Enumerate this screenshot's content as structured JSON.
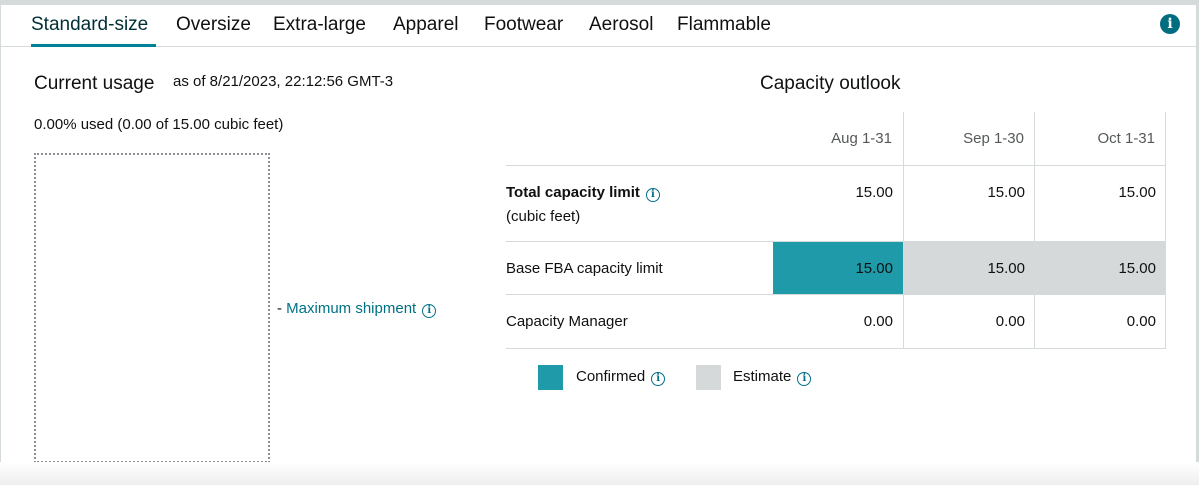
{
  "tabs": [
    {
      "label": "Standard-size",
      "active": true
    },
    {
      "label": "Oversize",
      "active": false
    },
    {
      "label": "Extra-large",
      "active": false
    },
    {
      "label": "Apparel",
      "active": false
    },
    {
      "label": "Footwear",
      "active": false
    },
    {
      "label": "Aerosol",
      "active": false
    },
    {
      "label": "Flammable",
      "active": false
    }
  ],
  "info_icon": "info-icon",
  "current_usage": {
    "title": "Current usage",
    "as_of": "as of 8/21/2023, 22:12:56 GMT-3",
    "used_text": "0.00% used (0.00 of 15.00 cubic feet)",
    "used_percent": 0,
    "max_shipment_dash": "-",
    "max_shipment_label": "Maximum shipment"
  },
  "capacity_outlook": {
    "title": "Capacity outlook",
    "columns": [
      "Aug 1-31",
      "Sep 1-30",
      "Oct 1-31"
    ],
    "rows": [
      {
        "label": "Total capacity limit",
        "sublabel": "(cubic feet)",
        "values": [
          "15.00",
          "15.00",
          "15.00"
        ]
      },
      {
        "label": "Base FBA capacity limit",
        "values": [
          "15.00",
          "15.00",
          "15.00"
        ]
      },
      {
        "label": "Capacity Manager",
        "values": [
          "0.00",
          "0.00",
          "0.00"
        ]
      }
    ]
  },
  "legend": {
    "confirmed_label": "Confirmed",
    "estimate_label": "Estimate"
  },
  "colors": {
    "accent": "#008296",
    "confirmed": "#1e9aa8",
    "estimate": "#d5d9d9",
    "link": "#007185"
  }
}
